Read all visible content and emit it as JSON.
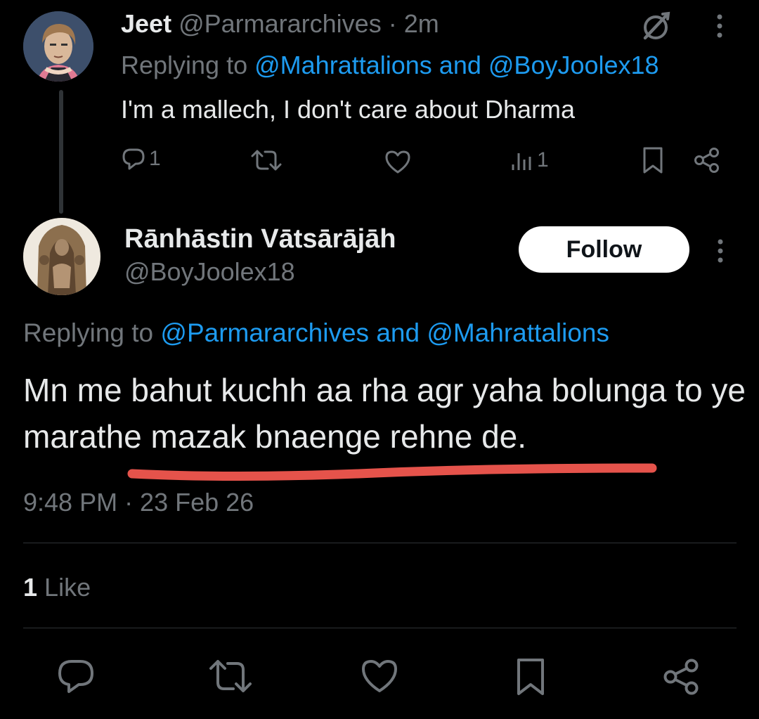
{
  "parent_tweet": {
    "author_name": "Jeet",
    "handle": "@Parmararchives",
    "separator": "·",
    "time_ago": "2m",
    "replying_prefix": "Replying to",
    "replying_mention1": "@Mahrattalions",
    "replying_and": "and",
    "replying_mention2": "@BoyJoolex18",
    "text": "I'm a mallech, I don't care about Dharma",
    "reply_count": "1",
    "view_count": "1"
  },
  "main_tweet": {
    "author_name": "Rānhāstin Vātsārājāh",
    "handle": "@BoyJoolex18",
    "follow_label": "Follow",
    "replying_prefix": "Replying to",
    "replying_mention1": "@Parmararchives",
    "replying_and": "and",
    "replying_mention2": "@Mahrattalions",
    "text": "Mn me bahut kuchh aa rha agr yaha bolunga to ye marathe mazak bnaenge rehne de.",
    "timestamp": "9:48 PM · 23 Feb 26",
    "like_count": "1",
    "like_label": "Like"
  },
  "colors": {
    "background": "#000000",
    "text": "#e7e9ea",
    "muted": "#71767b",
    "link": "#1d9bf0",
    "divider": "#2f3336",
    "annotation_underline": "#e5534b"
  },
  "icons": {
    "parent_actions": [
      "reply-icon",
      "retweet-icon",
      "like-icon",
      "views-icon",
      "bookmark-icon",
      "share-icon"
    ],
    "bottom_actions": [
      "reply-icon",
      "retweet-icon",
      "like-icon",
      "bookmark-icon",
      "share-icon"
    ],
    "header": [
      "grok-icon",
      "more-icon"
    ]
  }
}
